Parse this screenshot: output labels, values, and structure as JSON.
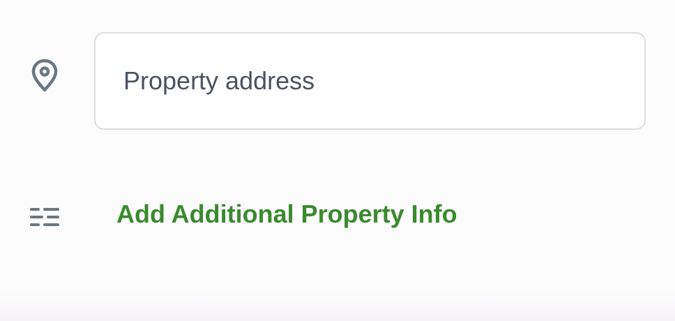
{
  "address": {
    "icon": "map-pin-icon",
    "placeholder": "Property address",
    "value": ""
  },
  "additional_info": {
    "icon": "sliders-icon",
    "label": "Add Additional Property Info",
    "color": "#3a8a2e"
  },
  "colors": {
    "icon": "#6b7680",
    "field_border": "#dcdcdc",
    "field_text": "#4b5360",
    "background": "#fdfcfd"
  }
}
